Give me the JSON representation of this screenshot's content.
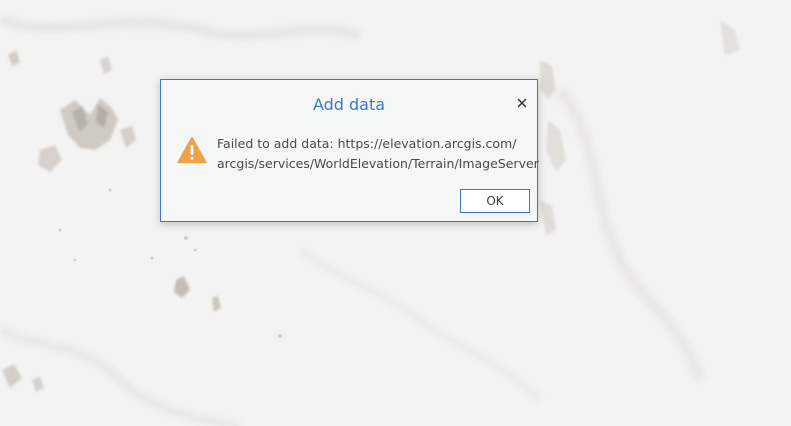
{
  "dialog": {
    "title": "Add data",
    "close_icon": "close-icon",
    "warning_icon": "warning-triangle-icon",
    "message_line1": "Failed to add data: https://elevation.arcgis.com/",
    "message_line2": "arcgis/services/WorldElevation/Terrain/ImageServer",
    "ok_label": "OK"
  },
  "colors": {
    "accent": "#3b78c4",
    "warning": "#f0a24a",
    "map_background": "#f3f3f1",
    "dialog_background": "#f5f7f7"
  }
}
